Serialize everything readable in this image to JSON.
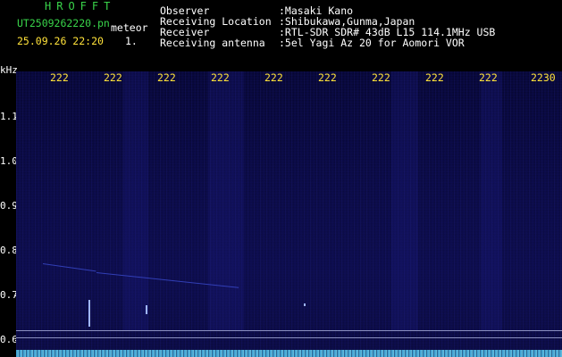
{
  "header": {
    "logo": "HROFFT",
    "file_name": "UT2509262220.pn",
    "meteor_label": "meteor",
    "date_time": "25.09.26 22:20",
    "meteor_count": "1.",
    "info": [
      {
        "label": "Observer",
        "value": ":Masaki Kano"
      },
      {
        "label": "Receiving Location",
        "value": ":Shibukawa,Gunma,Japan"
      },
      {
        "label": "Receiver",
        "value": ":RTL-SDR SDR# 43dB L15 114.1MHz USB"
      },
      {
        "label": "Receiving antenna",
        "value": ":5el Yagi Az 20 for Aomori VOR"
      }
    ]
  },
  "spectrogram": {
    "y_unit": "kHz",
    "y_ticks": [
      "1.1",
      "1.0",
      "0.9",
      "0.8",
      "0.7",
      "0.6"
    ],
    "x_ticks": [
      "222",
      "222",
      "222",
      "222",
      "222",
      "222",
      "222",
      "222",
      "222",
      "2230"
    ],
    "colors": {
      "background": "#000000",
      "tick_text": "#ffe23a",
      "logo": "#39d44a"
    }
  }
}
